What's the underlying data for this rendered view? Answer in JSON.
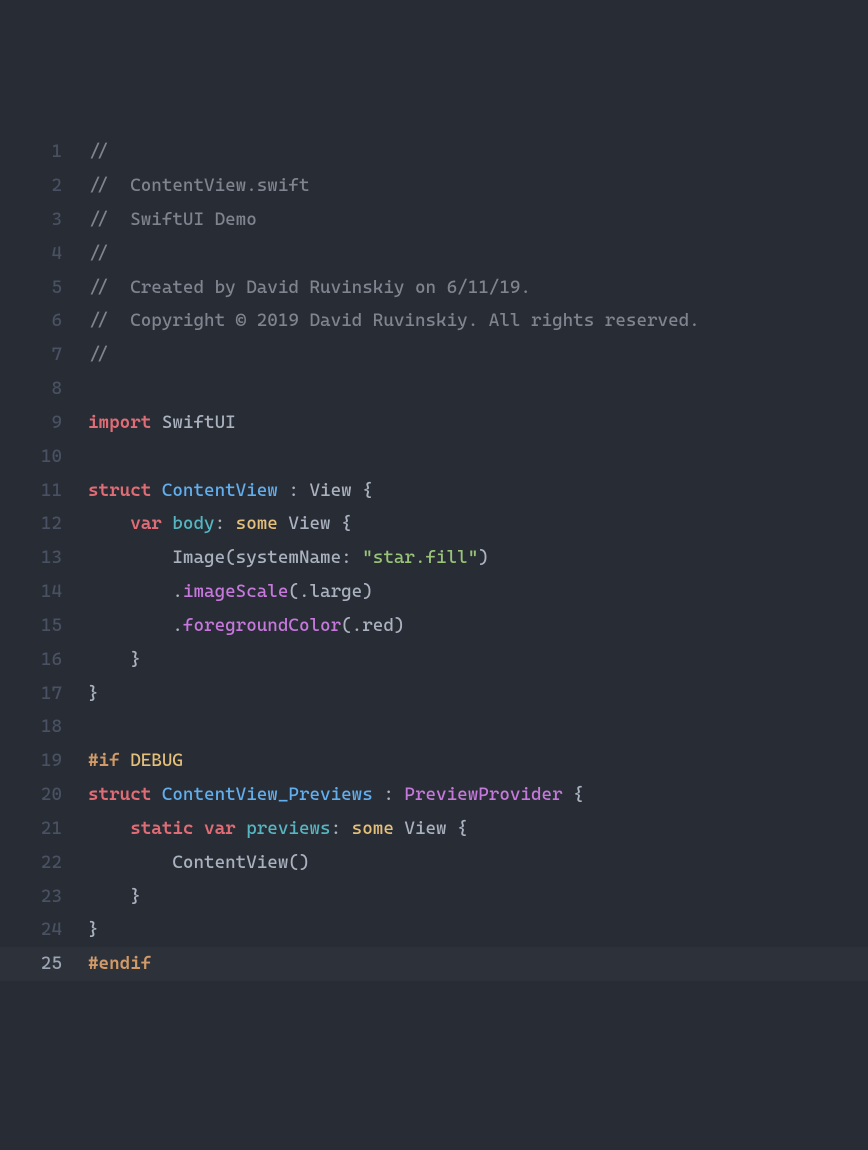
{
  "lines": [
    {
      "num": "1",
      "segments": [
        {
          "cls": "t-comment",
          "text": "//"
        }
      ]
    },
    {
      "num": "2",
      "segments": [
        {
          "cls": "t-comment",
          "text": "//  ContentView.swift"
        }
      ]
    },
    {
      "num": "3",
      "segments": [
        {
          "cls": "t-comment",
          "text": "//  SwiftUI Demo"
        }
      ]
    },
    {
      "num": "4",
      "segments": [
        {
          "cls": "t-comment",
          "text": "//"
        }
      ]
    },
    {
      "num": "5",
      "segments": [
        {
          "cls": "t-comment",
          "text": "//  Created by David Ruvinskiy on 6/11/19."
        }
      ]
    },
    {
      "num": "6",
      "segments": [
        {
          "cls": "t-comment",
          "text": "//  Copyright © 2019 David Ruvinskiy. All rights reserved."
        }
      ]
    },
    {
      "num": "7",
      "segments": [
        {
          "cls": "t-comment",
          "text": "//"
        }
      ]
    },
    {
      "num": "8",
      "segments": []
    },
    {
      "num": "9",
      "segments": [
        {
          "cls": "t-keyword",
          "text": "import"
        },
        {
          "cls": "t-plain",
          "text": " SwiftUI"
        }
      ]
    },
    {
      "num": "10",
      "segments": []
    },
    {
      "num": "11",
      "segments": [
        {
          "cls": "t-keyword",
          "text": "struct"
        },
        {
          "cls": "t-plain",
          "text": " "
        },
        {
          "cls": "t-type",
          "text": "ContentView"
        },
        {
          "cls": "t-plain",
          "text": " : View {"
        }
      ]
    },
    {
      "num": "12",
      "segments": [
        {
          "cls": "t-plain",
          "text": "    "
        },
        {
          "cls": "t-keyword",
          "text": "var"
        },
        {
          "cls": "t-plain",
          "text": " "
        },
        {
          "cls": "t-property",
          "text": "body"
        },
        {
          "cls": "t-plain",
          "text": ": "
        },
        {
          "cls": "t-some",
          "text": "some"
        },
        {
          "cls": "t-plain",
          "text": " View {"
        }
      ]
    },
    {
      "num": "13",
      "segments": [
        {
          "cls": "t-plain",
          "text": "        Image(systemName: "
        },
        {
          "cls": "t-string",
          "text": "\"star.fill\""
        },
        {
          "cls": "t-plain",
          "text": ")"
        }
      ]
    },
    {
      "num": "14",
      "segments": [
        {
          "cls": "t-plain",
          "text": "        ."
        },
        {
          "cls": "t-method",
          "text": "imageScale"
        },
        {
          "cls": "t-plain",
          "text": "(.large)"
        }
      ]
    },
    {
      "num": "15",
      "segments": [
        {
          "cls": "t-plain",
          "text": "        ."
        },
        {
          "cls": "t-method",
          "text": "foregroundColor"
        },
        {
          "cls": "t-plain",
          "text": "(.red)"
        }
      ]
    },
    {
      "num": "16",
      "segments": [
        {
          "cls": "t-plain",
          "text": "    }"
        }
      ]
    },
    {
      "num": "17",
      "segments": [
        {
          "cls": "t-plain",
          "text": "}"
        }
      ]
    },
    {
      "num": "18",
      "segments": []
    },
    {
      "num": "19",
      "segments": [
        {
          "cls": "t-preproc",
          "text": "#if"
        },
        {
          "cls": "t-plain",
          "text": " "
        },
        {
          "cls": "t-debug",
          "text": "DEBUG"
        }
      ]
    },
    {
      "num": "20",
      "segments": [
        {
          "cls": "t-keyword",
          "text": "struct"
        },
        {
          "cls": "t-plain",
          "text": " "
        },
        {
          "cls": "t-type",
          "text": "ContentView_Previews"
        },
        {
          "cls": "t-plain",
          "text": " : "
        },
        {
          "cls": "t-method",
          "text": "PreviewProvider"
        },
        {
          "cls": "t-plain",
          "text": " {"
        }
      ]
    },
    {
      "num": "21",
      "segments": [
        {
          "cls": "t-plain",
          "text": "    "
        },
        {
          "cls": "t-keyword",
          "text": "static"
        },
        {
          "cls": "t-plain",
          "text": " "
        },
        {
          "cls": "t-keyword",
          "text": "var"
        },
        {
          "cls": "t-plain",
          "text": " "
        },
        {
          "cls": "t-property",
          "text": "previews"
        },
        {
          "cls": "t-plain",
          "text": ": "
        },
        {
          "cls": "t-some",
          "text": "some"
        },
        {
          "cls": "t-plain",
          "text": " View {"
        }
      ]
    },
    {
      "num": "22",
      "segments": [
        {
          "cls": "t-plain",
          "text": "        ContentView()"
        }
      ]
    },
    {
      "num": "23",
      "segments": [
        {
          "cls": "t-plain",
          "text": "    }"
        }
      ]
    },
    {
      "num": "24",
      "segments": [
        {
          "cls": "t-plain",
          "text": "}"
        }
      ]
    },
    {
      "num": "25",
      "highlighted": true,
      "segments": [
        {
          "cls": "t-preproc",
          "text": "#endif"
        }
      ]
    }
  ]
}
